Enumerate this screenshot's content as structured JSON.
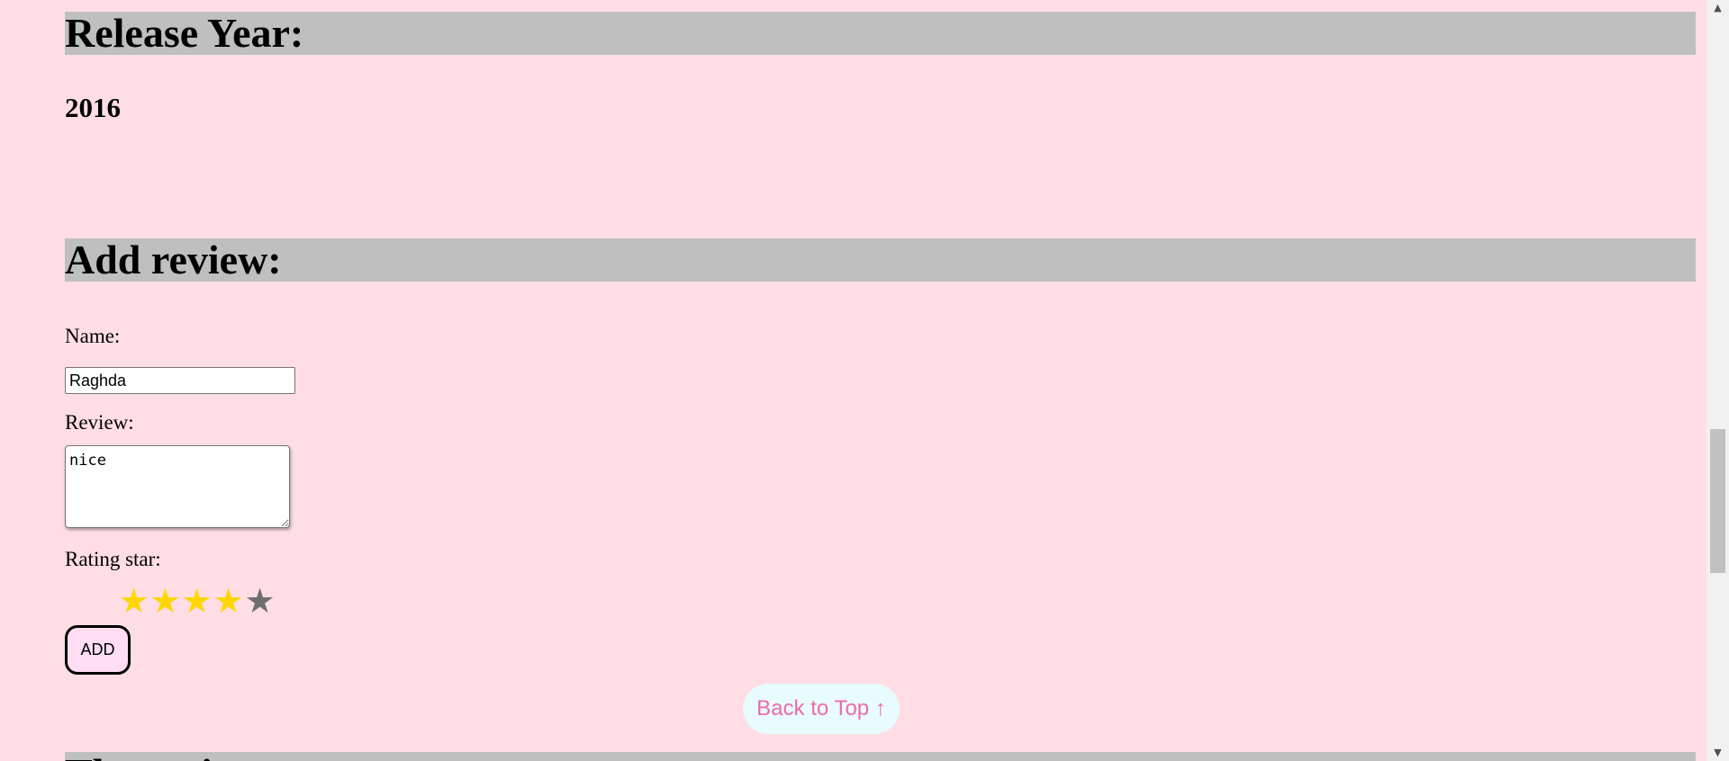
{
  "release_year": {
    "heading": "Release Year:",
    "value": "2016"
  },
  "add_review": {
    "heading": "Add review:",
    "name_label": "Name:",
    "name_value": "Raghda",
    "review_label": "Review:",
    "review_value": "nice",
    "rating_label": "Rating star:",
    "rating": {
      "value": 4,
      "max": 5,
      "filled_color": "#ffd700",
      "empty_color": "#6e6e6e"
    },
    "star_glyph": "★",
    "add_button": "ADD"
  },
  "back_to_top": "Back to Top ↑",
  "next_section": {
    "heading": "The reviews"
  },
  "scrollbar": {
    "up_icon": "▲",
    "down_icon": "▼"
  },
  "colors": {
    "page_background": "#ffdde5",
    "heading_background": "#bfbfbf",
    "back_to_top_text": "#f06aa8",
    "back_to_top_background": "#e8fbfd"
  }
}
